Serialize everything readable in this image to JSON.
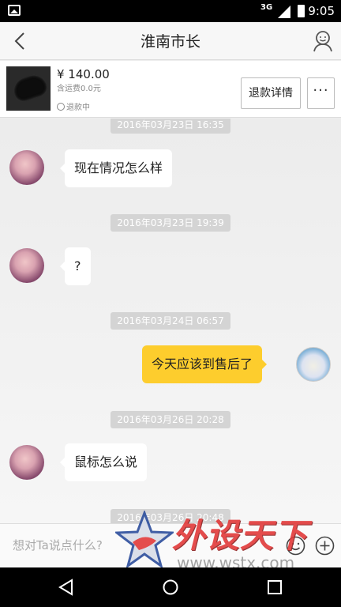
{
  "status_bar": {
    "network": "3G",
    "time": "9:05"
  },
  "header": {
    "title": "淮南市长"
  },
  "product": {
    "price": "¥ 140.00",
    "shipping": "含运费0.0元",
    "status": "退款中",
    "refund_button": "退款详情",
    "more_button": "···"
  },
  "messages": [
    {
      "timestamp": "2016年03月23日 16:35",
      "side": "left",
      "text": "现在情况怎么样"
    },
    {
      "timestamp": "2016年03月23日 19:39",
      "side": "left",
      "text": "?"
    },
    {
      "timestamp": "2016年03月24日 06:57",
      "side": "right",
      "text": "今天应该到售后了"
    },
    {
      "timestamp": "2016年03月26日 20:28",
      "side": "left",
      "text": "鼠标怎么说"
    },
    {
      "timestamp": "2016年03月26日 20:48"
    }
  ],
  "input": {
    "placeholder": "想对Ta说点什么?"
  },
  "watermark": {
    "title": "外设天下",
    "url": "www.wstx.com"
  },
  "colors": {
    "my_bubble": "#fdcd2d",
    "their_bubble": "#ffffff",
    "timestamp_bg": "#d4d4d4"
  }
}
